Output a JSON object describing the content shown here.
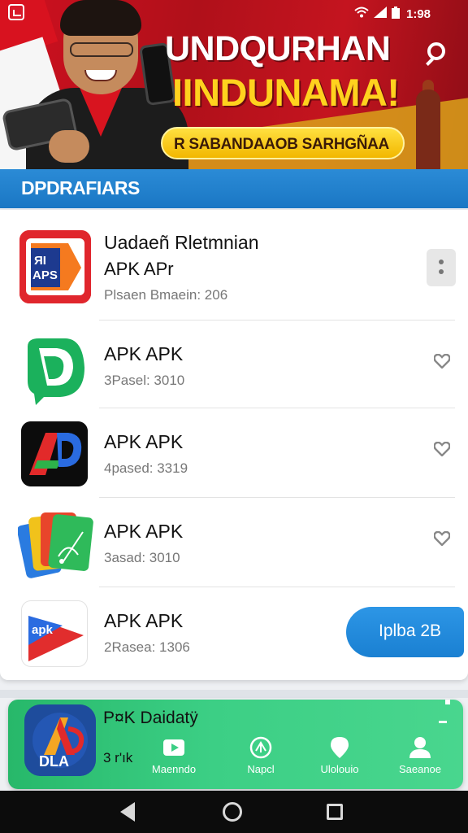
{
  "status_bar": {
    "time": "1:98",
    "notification_icon": "app-notification-icon",
    "icons": [
      "wifi-icon",
      "signal-icon",
      "battery-icon"
    ]
  },
  "hero": {
    "title_line1": "UNDQURHAN",
    "title_line2": "IINDUNAMA!",
    "pill_text": "R SABANDAAOB SARHGÑAA",
    "search_icon": "search-icon",
    "colors": {
      "red": "#c8101e",
      "gold": "#ffd21e",
      "pill": "#f2b700"
    }
  },
  "section": {
    "title": "DPDRAFIARS",
    "color": "#1a77c4"
  },
  "apps": [
    {
      "title": "Uadaeñ Rletmnian",
      "subtitle": "APK APr",
      "meta": "Plsaen Bmaein: 206",
      "action": "menu-icon"
    },
    {
      "title": "APK APK",
      "meta": "3Pasel: 3010",
      "action": "heart-icon"
    },
    {
      "title": "APK APK",
      "meta": "4pased: 3319",
      "action": "heart-icon"
    },
    {
      "title": "APK APK",
      "meta": "3asad: 3010",
      "action": "heart-icon"
    },
    {
      "title": "APK APK",
      "meta": "2Rasea: 1306",
      "action_label": "Iplba 2B"
    }
  ],
  "promo": {
    "title": "P¤K Daidatÿ",
    "subtitle": "3 r'ık",
    "icon_text": "DLA",
    "nav": [
      {
        "label": "Maenndo",
        "icon": "video-icon"
      },
      {
        "label": "Napcl",
        "icon": "compass-icon"
      },
      {
        "label": "Ulolouio",
        "icon": "location-pin-icon"
      },
      {
        "label": "Saeanoe",
        "icon": "profile-icon"
      }
    ],
    "color": "#3ccf85"
  },
  "system_nav": {
    "buttons": [
      "back-icon",
      "home-icon",
      "recents-icon"
    ]
  }
}
